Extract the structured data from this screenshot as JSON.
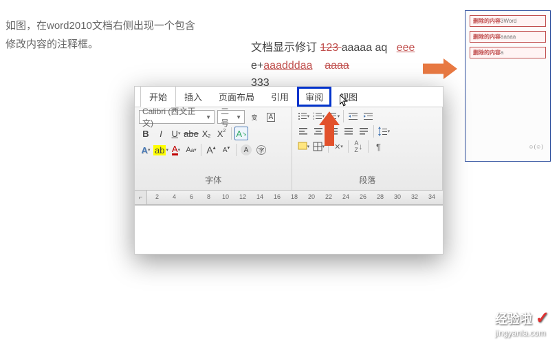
{
  "intro": {
    "line1": "如图，在word2010文档右侧出现一个包含",
    "line2": "修改内容的注释框。"
  },
  "tracked": {
    "line1a": "文档显示修订 ",
    "line1b": "123 ",
    "line1c": "aaaaa aq",
    "line1d": "eee",
    "line2a": "e+",
    "line2b": "aaadddaa",
    "line2c": "aaaa",
    "line3": "333"
  },
  "revisionBox": {
    "items": [
      {
        "label": "删除的内容",
        "val": "3Word"
      },
      {
        "label": "删除的内容",
        "val": "aaaaa"
      },
      {
        "label": "删除的内容",
        "val": "a"
      }
    ],
    "faded": "☺(☺)"
  },
  "ribbon": {
    "tabs": [
      "开始",
      "插入",
      "页面布局",
      "引用",
      "审阅",
      "视图"
    ],
    "fontName": "Calibri (西文正文)",
    "fontSize": "二号",
    "fontLabel": "字体",
    "paraLabel": "段落",
    "ruler": [
      "2",
      "4",
      "6",
      "8",
      "10",
      "12",
      "14",
      "16",
      "18",
      "20",
      "22",
      "24",
      "26",
      "28",
      "30",
      "32",
      "34"
    ]
  },
  "watermark": {
    "title": "经验啦",
    "url": "jingyanla.com"
  }
}
